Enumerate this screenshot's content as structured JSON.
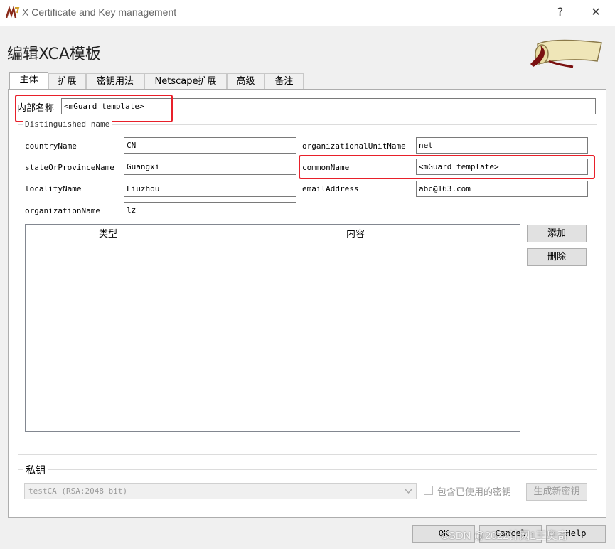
{
  "window": {
    "title": "X Certificate and Key management",
    "help_glyph": "?",
    "close_glyph": "✕"
  },
  "dialog": {
    "title": "编辑XCA模板"
  },
  "tabs": [
    {
      "label": "主体",
      "active": true
    },
    {
      "label": "扩展",
      "active": false
    },
    {
      "label": "密钥用法",
      "active": false
    },
    {
      "label": "Netscape扩展",
      "active": false
    },
    {
      "label": "高级",
      "active": false
    },
    {
      "label": "备注",
      "active": false
    }
  ],
  "subject": {
    "internal_name_label": "内部名称",
    "internal_name_value": "<mGuard template>",
    "dn_legend": "Distinguished name",
    "fields": {
      "countryName": {
        "label": "countryName",
        "value": "CN"
      },
      "stateOrProvinceName": {
        "label": "stateOrProvinceName",
        "value": "Guangxi"
      },
      "localityName": {
        "label": "localityName",
        "value": "Liuzhou"
      },
      "organizationName": {
        "label": "organizationName",
        "value": "lz"
      },
      "organizationalUnitName": {
        "label": "organizationalUnitName",
        "value": "net"
      },
      "commonName": {
        "label": "commonName",
        "value": "<mGuard template>"
      },
      "emailAddress": {
        "label": "emailAddress",
        "value": "abc@163.com"
      }
    },
    "table": {
      "columns": [
        "类型",
        "内容"
      ],
      "rows": []
    },
    "add_label": "添加",
    "delete_label": "删除"
  },
  "private_key": {
    "legend": "私钥",
    "selected_key": "testCA (RSA:2048 bit)",
    "include_used_label": "包含已使用的密钥",
    "include_used_checked": false,
    "generate_label": "生成新密钥"
  },
  "footer": {
    "ok_label": "OK",
    "cancel_label": "Cancel",
    "help_label": "Help",
    "watermark": "CSDN @2022计网1王奥奇"
  },
  "colors": {
    "highlight_box": "#e8202a",
    "window_bg": "#f0f0f0"
  }
}
